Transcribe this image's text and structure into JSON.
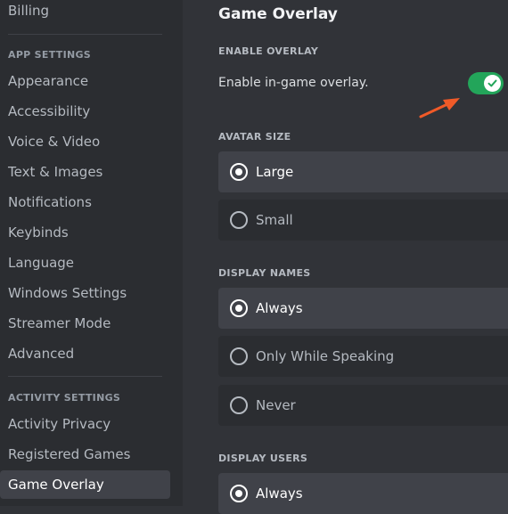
{
  "sidebar": {
    "billing": "Billing",
    "app_settings_header": "APP SETTINGS",
    "app_items": [
      "Appearance",
      "Accessibility",
      "Voice & Video",
      "Text & Images",
      "Notifications",
      "Keybinds",
      "Language",
      "Windows Settings",
      "Streamer Mode",
      "Advanced"
    ],
    "activity_settings_header": "ACTIVITY SETTINGS",
    "activity_items": [
      "Activity Privacy",
      "Registered Games",
      "Game Overlay"
    ],
    "selected": "Game Overlay"
  },
  "main": {
    "title": "Game Overlay",
    "enable_overlay": {
      "label": "ENABLE OVERLAY",
      "text": "Enable in-game overlay.",
      "enabled": true
    },
    "avatar_size": {
      "label": "AVATAR SIZE",
      "options": [
        "Large",
        "Small"
      ],
      "selected": "Large"
    },
    "display_names": {
      "label": "DISPLAY NAMES",
      "options": [
        "Always",
        "Only While Speaking",
        "Never"
      ],
      "selected": "Always"
    },
    "display_users": {
      "label": "DISPLAY USERS",
      "options": [
        "Always"
      ],
      "selected": "Always"
    }
  },
  "colors": {
    "sidebar_bg": "#2b2d31",
    "main_bg": "#313338",
    "selected_bg": "#404249",
    "toggle_on": "#23a55a",
    "annotation_arrow": "#f05a28"
  }
}
